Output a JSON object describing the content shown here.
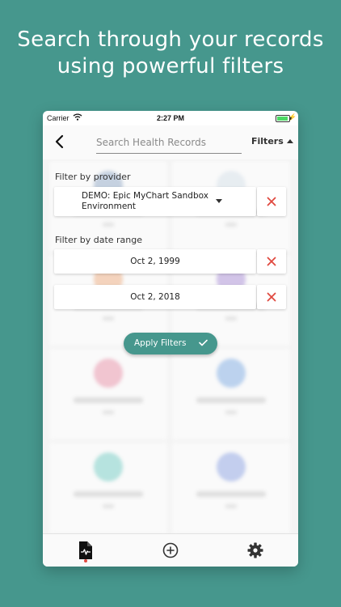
{
  "headline": {
    "line1": "Search through your records",
    "line2": "using powerful filters"
  },
  "status_bar": {
    "carrier": "Carrier",
    "time": "2:27 PM"
  },
  "search": {
    "placeholder": "Search Health Records",
    "value": "",
    "filters_label": "Filters"
  },
  "filters": {
    "provider_label": "Filter by provider",
    "provider_value": "DEMO: Epic MyChart Sandbox Environment",
    "date_range_label": "Filter by date range",
    "start_date": "Oct 2, 1999",
    "end_date": "Oct 2, 2018",
    "apply_label": "Apply Filters"
  },
  "tabs": [
    {
      "name": "records",
      "icon": "records-icon",
      "active": true
    },
    {
      "name": "add",
      "icon": "add-circle-icon",
      "active": false
    },
    {
      "name": "settings",
      "icon": "gear-icon",
      "active": false
    }
  ],
  "colors": {
    "brand": "#46978d",
    "clear_red": "#e0493f",
    "active_dot": "#e0493f"
  }
}
